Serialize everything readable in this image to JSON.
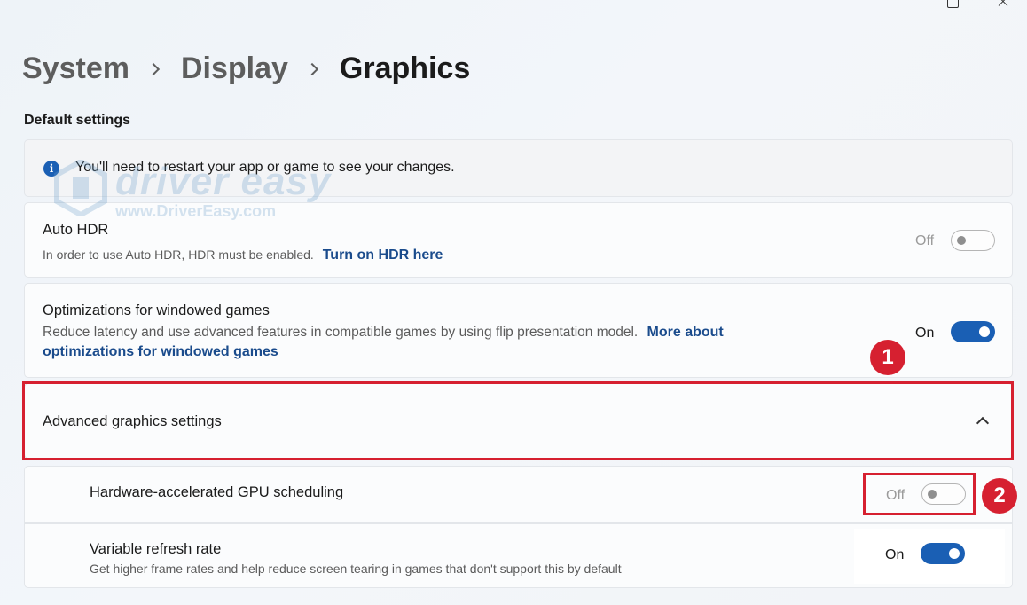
{
  "window": {
    "minimize_icon": "minimize-icon",
    "maximize_icon": "maximize-icon",
    "close_icon": "close-icon"
  },
  "breadcrumb": {
    "items": [
      "System",
      "Display",
      "Graphics"
    ]
  },
  "section_title": "Default settings",
  "info_banner": {
    "icon": "info-icon",
    "icon_glyph": "i",
    "text": "You'll need to restart your app or game to see your changes."
  },
  "auto_hdr": {
    "title": "Auto HDR",
    "description": "In order to use Auto HDR, HDR must be enabled.",
    "link": "Turn on HDR here",
    "toggle_label": "Off",
    "toggle_state": false
  },
  "windowed_games": {
    "title": "Optimizations for windowed games",
    "description": "Reduce latency and use advanced features in compatible games by using flip presentation model.",
    "link_part1": "More about",
    "link_part2": "optimizations for windowed games",
    "toggle_label": "On",
    "toggle_state": true
  },
  "advanced": {
    "title": "Advanced graphics settings",
    "expanded": true,
    "chevron_icon": "chevron-up-icon"
  },
  "gpu_scheduling": {
    "title": "Hardware-accelerated GPU scheduling",
    "toggle_label": "Off",
    "toggle_state": false
  },
  "variable_refresh": {
    "title": "Variable refresh rate",
    "description": "Get higher frame rates and help reduce screen tearing in games that don't support this by default",
    "toggle_label": "On",
    "toggle_state": true
  },
  "annotations": {
    "badge_1": "1",
    "badge_2": "2",
    "color": "#d62030"
  },
  "watermark": {
    "name": "driver easy",
    "url": "www.DriverEasy.com"
  },
  "colors": {
    "accent": "#1a5fb4",
    "link": "#1a4b8c",
    "annotation_red": "#d62030"
  }
}
